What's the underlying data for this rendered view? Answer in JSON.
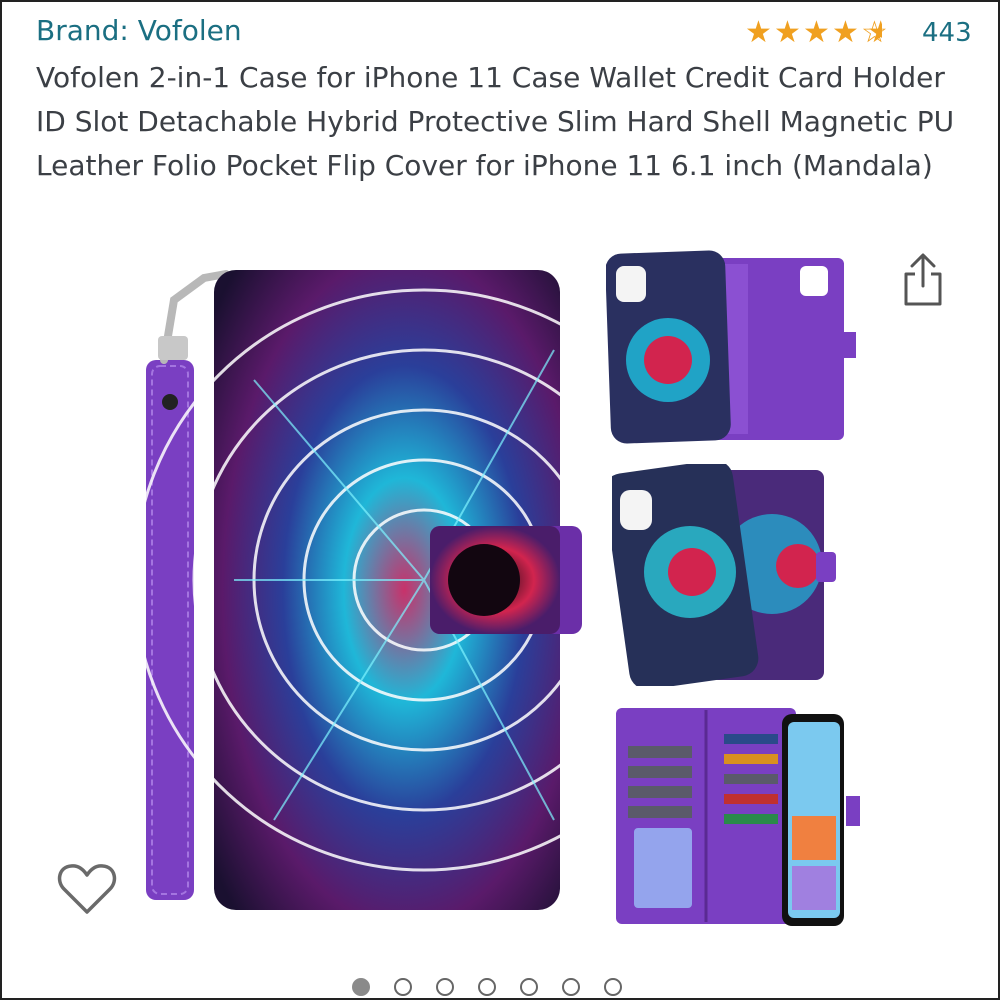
{
  "product": {
    "brand": "Brand: Vofolen",
    "rating_value": 4.5,
    "rating_max": 5,
    "review_count": "443",
    "title": "Vofolen 2-in-1 Case for iPhone 11 Case Wallet Credit Card Holder ID Slot Detachable Hybrid Protective Slim Hard Shell Magnetic PU Leather Folio Pocket Flip Cover for iPhone 11 6.1 inch (Mandala)"
  },
  "gallery": {
    "image_count": 7,
    "active_index": 0,
    "thumbnails": [
      "case-detached-open",
      "phone-and-wallet-separated",
      "wallet-card-slots-open"
    ]
  },
  "icons": {
    "share": "share-icon",
    "wishlist": "heart-outline-icon",
    "rating": "star-icon"
  },
  "colors": {
    "brand_link": "#1b6f82",
    "star": "#f0a020",
    "title": "#3b3f45",
    "case_purple": "#7a3fc2"
  }
}
